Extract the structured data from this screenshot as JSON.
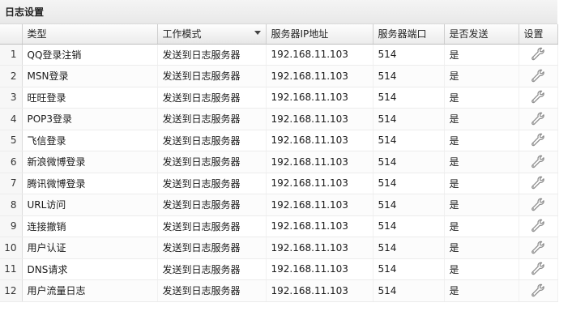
{
  "panel": {
    "title": "日志设置"
  },
  "columns": {
    "type": "类型",
    "mode": "工作模式",
    "server_ip": "服务器IP地址",
    "server_port": "服务器端口",
    "send": "是否发送",
    "settings": "设置"
  },
  "rows": [
    {
      "num": "1",
      "type": "QQ登录注销",
      "mode": "发送到日志服务器",
      "ip": "192.168.11.103",
      "port": "514",
      "send": "是",
      "icon": "wrench-icon"
    },
    {
      "num": "2",
      "type": "MSN登录",
      "mode": "发送到日志服务器",
      "ip": "192.168.11.103",
      "port": "514",
      "send": "是",
      "icon": "wrench-icon"
    },
    {
      "num": "3",
      "type": "旺旺登录",
      "mode": "发送到日志服务器",
      "ip": "192.168.11.103",
      "port": "514",
      "send": "是",
      "icon": "wrench-icon"
    },
    {
      "num": "4",
      "type": "POP3登录",
      "mode": "发送到日志服务器",
      "ip": "192.168.11.103",
      "port": "514",
      "send": "是",
      "icon": "wrench-icon"
    },
    {
      "num": "5",
      "type": "飞信登录",
      "mode": "发送到日志服务器",
      "ip": "192.168.11.103",
      "port": "514",
      "send": "是",
      "icon": "wrench-icon"
    },
    {
      "num": "6",
      "type": "新浪微博登录",
      "mode": "发送到日志服务器",
      "ip": "192.168.11.103",
      "port": "514",
      "send": "是",
      "icon": "wrench-icon"
    },
    {
      "num": "7",
      "type": "腾讯微博登录",
      "mode": "发送到日志服务器",
      "ip": "192.168.11.103",
      "port": "514",
      "send": "是",
      "icon": "wrench-icon"
    },
    {
      "num": "8",
      "type": "URL访问",
      "mode": "发送到日志服务器",
      "ip": "192.168.11.103",
      "port": "514",
      "send": "是",
      "icon": "wrench-icon"
    },
    {
      "num": "9",
      "type": "连接撤销",
      "mode": "发送到日志服务器",
      "ip": "192.168.11.103",
      "port": "514",
      "send": "是",
      "icon": "wrench-icon"
    },
    {
      "num": "10",
      "type": "用户认证",
      "mode": "发送到日志服务器",
      "ip": "192.168.11.103",
      "port": "514",
      "send": "是",
      "icon": "wrench-icon"
    },
    {
      "num": "11",
      "type": "DNS请求",
      "mode": "发送到日志服务器",
      "ip": "192.168.11.103",
      "port": "514",
      "send": "是",
      "icon": "wrench-icon"
    },
    {
      "num": "12",
      "type": "用户流量日志",
      "mode": "发送到日志服务器",
      "ip": "192.168.11.103",
      "port": "514",
      "send": "是",
      "icon": "wrench-icon"
    }
  ],
  "colors": {
    "header_bg": "#ececec",
    "border": "#cfcfcf",
    "wrench": "#8a8a8a"
  }
}
